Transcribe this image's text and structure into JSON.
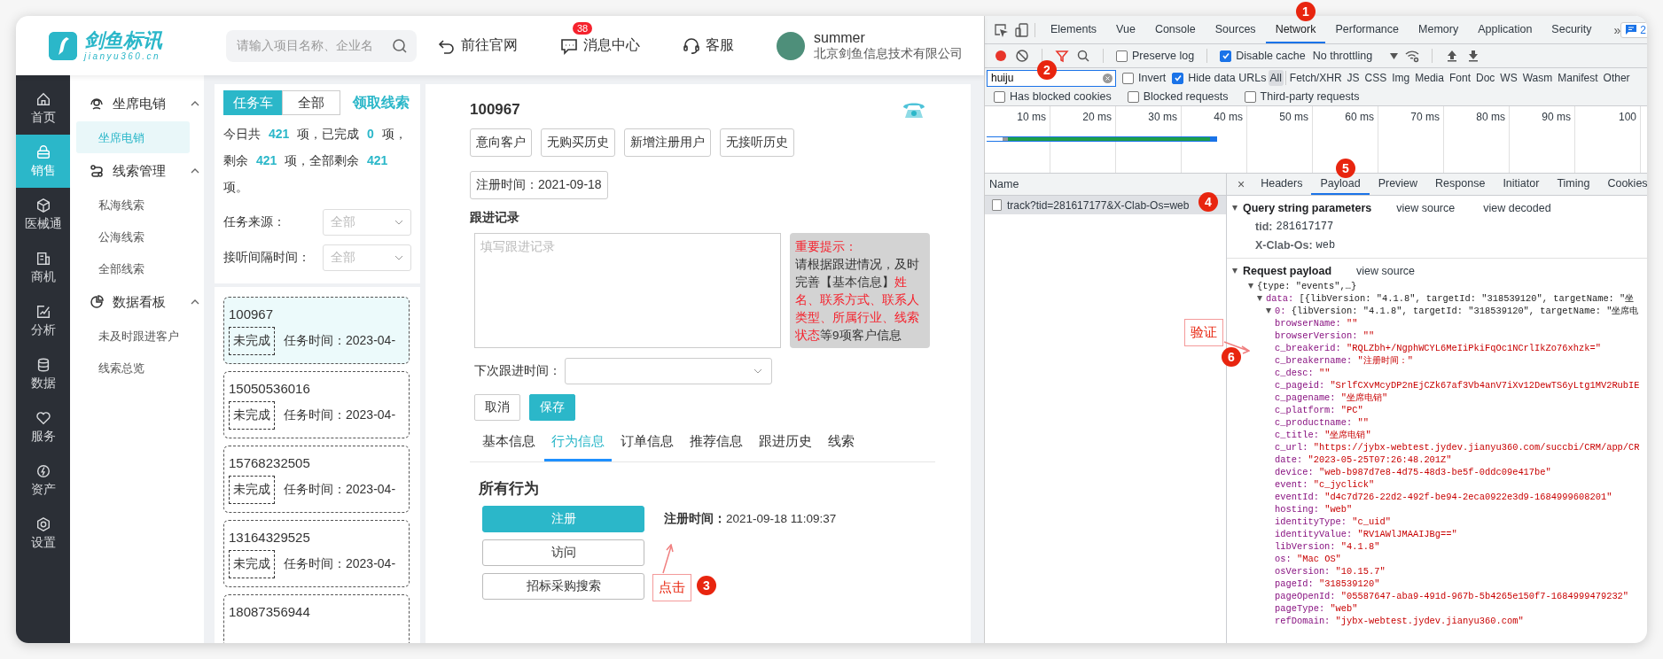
{
  "header": {
    "logo": {
      "name": "剑鱼标讯",
      "domain": "jianyu360.cn"
    },
    "search": {
      "placeholder": "请输入项目名称、企业名"
    },
    "links": [
      {
        "kind": "back",
        "label": "前往官网"
      },
      {
        "kind": "message",
        "label": "消息中心",
        "badge": "38"
      },
      {
        "kind": "service",
        "label": "客服"
      }
    ],
    "user": {
      "name": "summer",
      "company": "北京剑鱼信息技术有限公司"
    }
  },
  "nav": [
    {
      "kind": "home",
      "label": "首页",
      "selected": false
    },
    {
      "kind": "sales",
      "label": "销售",
      "selected": true
    },
    {
      "kind": "cube",
      "label": "医械通",
      "selected": false
    },
    {
      "kind": "business",
      "label": "商机",
      "selected": false
    },
    {
      "kind": "analysis",
      "label": "分析",
      "selected": false
    },
    {
      "kind": "data",
      "label": "数据",
      "selected": false
    },
    {
      "kind": "service",
      "label": "服务",
      "selected": false
    },
    {
      "kind": "asset",
      "label": "资产",
      "selected": false
    },
    {
      "kind": "settings",
      "label": "设置",
      "selected": false
    }
  ],
  "menu": [
    {
      "kind": "headset",
      "label": "坐席电销",
      "expanded": true,
      "children": [
        {
          "label": "坐席电销",
          "selected": true
        }
      ]
    },
    {
      "kind": "route",
      "label": "线索管理",
      "expanded": true,
      "children": [
        {
          "label": "私海线索",
          "selected": false
        },
        {
          "label": "公海线索",
          "selected": false
        },
        {
          "label": "全部线索",
          "selected": false
        }
      ]
    },
    {
      "kind": "pie",
      "label": "数据看板",
      "expanded": true,
      "children": [
        {
          "label": "未及时跟进客户",
          "selected": false
        },
        {
          "label": "线索总览",
          "selected": false
        }
      ]
    }
  ],
  "tasks": {
    "tabs": [
      {
        "label": "任务车",
        "selected": true
      },
      {
        "label": "全部",
        "selected": false
      }
    ],
    "action": "领取线索",
    "summary": "今日共 **421** 项，已完成 **0** 项，剩余 **421** 项，全部剩余 **421** 项。",
    "filters": [
      {
        "label": "任务来源：",
        "placeholder": "全部"
      },
      {
        "label": "接听间隔时间：",
        "placeholder": "全部"
      }
    ],
    "items": [
      {
        "phone": "100967",
        "status": "未完成",
        "time": "任务时间：2023-04-",
        "selected": true
      },
      {
        "phone": "15050536016",
        "status": "未完成",
        "time": "任务时间：2023-04-",
        "selected": false
      },
      {
        "phone": "15768232505",
        "status": "未完成",
        "time": "任务时间：2023-04-",
        "selected": false
      },
      {
        "phone": "13164329525",
        "status": "未完成",
        "time": "任务时间：2023-04-",
        "selected": false
      },
      {
        "phone": "18087356944",
        "selected": false
      }
    ]
  },
  "detail": {
    "id": "100967",
    "tags": [
      "意向客户",
      "无购买历史",
      "新增注册用户",
      "无接听历史"
    ],
    "reg_tag": "注册时间：2021-09-18",
    "record_label": "跟进记录",
    "record": {
      "placeholder": "填写跟进记录"
    },
    "notice": {
      "title": "重要提示：",
      "segments": [
        {
          "text": "请根据跟进情况，及时完善【基本信息】",
          "highlight": false
        },
        {
          "text": "姓名、联系方式、联系人类型、所属行业、线索状态",
          "highlight": true
        },
        {
          "text": "等9项客户信息",
          "highlight": false
        }
      ]
    },
    "next_time": {
      "label": "下次跟进时间："
    },
    "buttons": [
      {
        "kind": "cancel",
        "label": "取消"
      },
      {
        "kind": "save",
        "label": "保存"
      }
    ],
    "tabs": [
      {
        "label": "基本信息",
        "selected": false
      },
      {
        "label": "行为信息",
        "selected": true
      },
      {
        "label": "订单信息",
        "selected": false
      },
      {
        "label": "推荐信息",
        "selected": false
      },
      {
        "label": "跟进历史",
        "selected": false
      },
      {
        "label": "线索",
        "selected": false
      }
    ],
    "section_title": "所有行为",
    "actions": [
      {
        "label": "注册",
        "selected": true
      },
      {
        "label": "访问",
        "selected": false
      },
      {
        "label": "招标采购搜索",
        "selected": false
      }
    ],
    "action_detail": "**注册时间：**2021-09-18 11:09:37"
  },
  "devtools": {
    "tabs": [
      {
        "label": "Elements",
        "selected": false
      },
      {
        "label": "Vue",
        "selected": false
      },
      {
        "label": "Console",
        "selected": false
      },
      {
        "label": "Sources",
        "selected": false
      },
      {
        "label": "Network",
        "selected": true
      },
      {
        "label": "Performance",
        "selected": false
      },
      {
        "label": "Memory",
        "selected": false
      },
      {
        "label": "Application",
        "selected": false
      },
      {
        "label": "Security",
        "selected": false
      }
    ],
    "more": "»",
    "issues": "2",
    "options": [
      {
        "label": "Preserve log",
        "checked": false
      },
      {
        "label": "Disable cache",
        "checked": true
      }
    ],
    "throttling": "No throttling",
    "filter": {
      "value": "huiju"
    },
    "filter_options": [
      {
        "label": "Invert",
        "checked": false
      },
      {
        "label": "Hide data URLs",
        "checked": true
      }
    ],
    "types": [
      {
        "label": "All",
        "selected": true
      },
      {
        "label": "Fetch/XHR",
        "selected": false
      },
      {
        "label": "JS",
        "selected": false
      },
      {
        "label": "CSS",
        "selected": false
      },
      {
        "label": "Img",
        "selected": false
      },
      {
        "label": "Media",
        "selected": false
      },
      {
        "label": "Font",
        "selected": false
      },
      {
        "label": "Doc",
        "selected": false
      },
      {
        "label": "WS",
        "selected": false
      },
      {
        "label": "Wasm",
        "selected": false
      },
      {
        "label": "Manifest",
        "selected": false
      },
      {
        "label": "Other",
        "selected": false
      }
    ],
    "blocked": [
      {
        "label": "Has blocked cookies",
        "checked": false
      },
      {
        "label": "Blocked requests",
        "checked": false
      },
      {
        "label": "Third-party requests",
        "checked": false
      }
    ],
    "timeline": [
      "10 ms",
      "20 ms",
      "30 ms",
      "40 ms",
      "50 ms",
      "60 ms",
      "70 ms",
      "80 ms",
      "90 ms",
      "100"
    ],
    "name_header": "Name",
    "requests": [
      {
        "name": "track?tid=281617177&X-Clab-Os=web",
        "selected": true
      }
    ],
    "close": "×",
    "detail_tabs": [
      {
        "label": "Headers",
        "selected": false
      },
      {
        "label": "Payload",
        "selected": true
      },
      {
        "label": "Preview",
        "selected": false
      },
      {
        "label": "Response",
        "selected": false
      },
      {
        "label": "Initiator",
        "selected": false
      },
      {
        "label": "Timing",
        "selected": false
      },
      {
        "label": "Cookies",
        "selected": false
      }
    ],
    "query": {
      "title": "Query string parameters",
      "links": [
        "view source",
        "view decoded"
      ],
      "params": [
        {
          "key": "tid:",
          "value": "281617177"
        },
        {
          "key": "X-Clab-Os:",
          "value": "web"
        }
      ]
    },
    "payload": {
      "title": "Request payload",
      "links": [
        "view source"
      ],
      "tree": [
        {
          "value": "{type: \"events\",…}",
          "children": [
            {
              "key": "data:",
              "value": "[{libVersion: \"4.1.8\", targetId: \"318539120\", targetName: \"坐",
              "children": [
                {
                  "key": "0:",
                  "value": "{libVersion: \"4.1.8\", targetId: \"318539120\", targetName: \"坐席电",
                  "children": [
                    {
                      "key": "browserName:",
                      "value": "\"\""
                    },
                    {
                      "key": "browserVersion:",
                      "value": "\"\""
                    },
                    {
                      "key": "c_breakerid:",
                      "value": "\"RQLZbh+/NgphWCYL6MeIiPkiFqOc1NCrlIkZo76xhzk=\""
                    },
                    {
                      "key": "c_breakername:",
                      "value": "\"注册时间：\""
                    },
                    {
                      "key": "c_desc:",
                      "value": "\"\""
                    },
                    {
                      "key": "c_pageid:",
                      "value": "\"SrlfCXvMcyDP2nEjCZk67af3Vb4anV7iXv12DewTS6yLtg1MV2RubIE"
                    },
                    {
                      "key": "c_pagename:",
                      "value": "\"坐席电销\""
                    },
                    {
                      "key": "c_platform:",
                      "value": "\"PC\""
                    },
                    {
                      "key": "c_productname:",
                      "value": "\"\""
                    },
                    {
                      "key": "c_title:",
                      "value": "\"坐席电销\""
                    },
                    {
                      "key": "c_url:",
                      "value": "\"https://jybx-webtest.jydev.jianyu360.com/succbi/CRM/app/CR"
                    },
                    {
                      "key": "date:",
                      "value": "\"2023-05-25T07:26:48.201Z\""
                    },
                    {
                      "key": "device:",
                      "value": "\"web-b987d7e8-4d75-48d3-be5f-0ddc09e417be\""
                    },
                    {
                      "key": "event:",
                      "value": "\"c_jyclick\""
                    },
                    {
                      "key": "eventId:",
                      "value": "\"d4c7d726-22d2-492f-be94-2eca0922e3d9-1684999608201\""
                    },
                    {
                      "key": "hosting:",
                      "value": "\"web\""
                    },
                    {
                      "key": "identityType:",
                      "value": "\"c_uid\""
                    },
                    {
                      "key": "identityValue:",
                      "value": "\"RV1AWlJMAAIJBg==\""
                    },
                    {
                      "key": "libVersion:",
                      "value": "\"4.1.8\""
                    },
                    {
                      "key": "os:",
                      "value": "\"Mac OS\""
                    },
                    {
                      "key": "osVersion:",
                      "value": "\"10.15.7\""
                    },
                    {
                      "key": "pageId:",
                      "value": "\"318539120\""
                    },
                    {
                      "key": "pageOpenId:",
                      "value": "\"05587647-aba9-491d-967b-5b4265e150f7-1684999479232\""
                    },
                    {
                      "key": "pageType:",
                      "value": "\"web\""
                    },
                    {
                      "key": "refDomain:",
                      "value": "\"jybx-webtest.jydev.jianyu360.com\""
                    }
                  ]
                }
              ]
            }
          ]
        }
      ]
    }
  },
  "annotations": [
    {
      "number": "1"
    },
    {
      "number": "2"
    },
    {
      "number": "3",
      "label": "点击"
    },
    {
      "number": "4"
    },
    {
      "number": "5"
    },
    {
      "number": "6",
      "label": "验证"
    }
  ]
}
